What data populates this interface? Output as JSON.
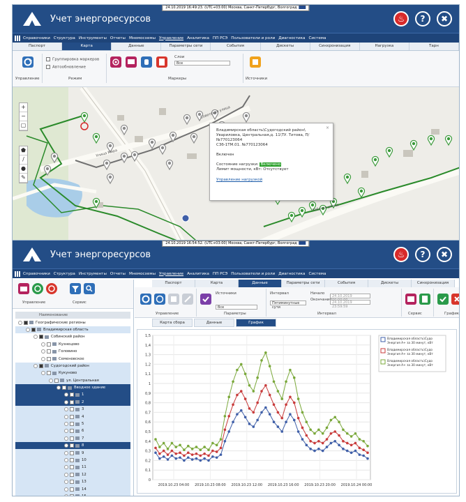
{
  "top_window": {
    "clock": "24.10.2019 16:49:23. (UTC+03:00) Москва, Санкт-Петербург, Волгоград",
    "app_title": "Учет энергоресурсов",
    "menu": [
      "Справочники",
      "Структура",
      "Инструменты",
      "Отчеты",
      "Мнемосхемы",
      "Управление",
      "Аналитика",
      "ПП РСЭ",
      "Пользователи и роли",
      "Диагностика",
      "Система"
    ],
    "active_menu": "Управление",
    "tabs": [
      "Паспорт",
      "Карта",
      "Данные",
      "Параметры сети",
      "События",
      "Дискеты",
      "Синхронизация",
      "Нагрузка",
      "Тарн"
    ],
    "active_tab": "Карта",
    "ribbon": {
      "group_marker_label": "Группировка маркеров",
      "auto_update_label": "Автообновление",
      "mode_label": "Режим",
      "control_label": "Управление",
      "layer_label": "Слои",
      "layer_value": "Все",
      "markers_label": "Маркеры",
      "sources_label": "Источники"
    },
    "popup": {
      "address": "Владимирская область\\Судогодский район\\",
      "street": "Увариловка, Центральная,д. 11\\ТУ. Титова, П/",
      "meter1": "№770123064",
      "meter2": "С3б-1ТМ.01. №770123064",
      "state_line": "Включен",
      "load_state_label": "Состояние нагрузки:",
      "load_state_value": "Включено",
      "power_limit": "Лимит мощности, кВт: Отсутствует",
      "link": "Управление нагрузкой"
    },
    "map_labels": [
      "Улица Мира",
      "Советская улица",
      "Рабочая улица"
    ]
  },
  "bottom_window": {
    "clock": "24.10.2019 16:54:52. (UTC+03:00) Москва, Санкт-Петербург, Волгоград",
    "app_title": "Учет энергоресурсов",
    "menu": [
      "Справочники",
      "Структура",
      "Инструменты",
      "Отчеты",
      "Мнемосхемы",
      "Управление",
      "Аналитика",
      "ПП РСЭ",
      "Пользователи и роли",
      "Диагностика",
      "Система"
    ],
    "active_menu": "Управление",
    "left_ribbon": {
      "control_label": "Управление",
      "service_label": "Сервис"
    },
    "tree_header": "Наименование",
    "tree": [
      {
        "label": "Географические регионы",
        "level": 0,
        "state": "none"
      },
      {
        "label": "Владимирская область",
        "level": 1,
        "state": "sel"
      },
      {
        "label": "Собинский район",
        "level": 2,
        "state": "none"
      },
      {
        "label": "Кузнецово",
        "level": 3,
        "state": "none"
      },
      {
        "label": "Головино",
        "level": 3,
        "state": "none"
      },
      {
        "label": "Семеновское",
        "level": 3,
        "state": "none"
      },
      {
        "label": "Судогодский район",
        "level": 2,
        "state": "sel"
      },
      {
        "label": "Кукуново",
        "level": 3,
        "state": "sel"
      },
      {
        "label": "ул. Центральная",
        "level": 4,
        "state": "sel"
      },
      {
        "label": "Вводное здание",
        "level": 5,
        "state": "hl"
      },
      {
        "label": "1",
        "level": 6,
        "state": "hl"
      },
      {
        "label": "2",
        "level": 6,
        "state": "hl"
      },
      {
        "label": "3",
        "level": 6,
        "state": "sel"
      },
      {
        "label": "4",
        "level": 6,
        "state": "sel"
      },
      {
        "label": "5",
        "level": 6,
        "state": "sel"
      },
      {
        "label": "6",
        "level": 6,
        "state": "sel"
      },
      {
        "label": "7",
        "level": 6,
        "state": "sel"
      },
      {
        "label": "8",
        "level": 6,
        "state": "hl"
      },
      {
        "label": "9",
        "level": 6,
        "state": "sel"
      },
      {
        "label": "10",
        "level": 6,
        "state": "sel"
      },
      {
        "label": "11",
        "level": 6,
        "state": "sel"
      },
      {
        "label": "12",
        "level": 6,
        "state": "sel"
      },
      {
        "label": "13",
        "level": 6,
        "state": "sel"
      },
      {
        "label": "14",
        "level": 6,
        "state": "sel"
      },
      {
        "label": "15",
        "level": 6,
        "state": "sel"
      }
    ],
    "tabs": [
      "Паспорт",
      "Карта",
      "Данные",
      "Параметры сети",
      "События",
      "Дискеты",
      "Синхронизация"
    ],
    "active_tab": "Данные",
    "ribbon": {
      "control_label": "Управление",
      "sources_label": "Источники",
      "sources_value": "Все",
      "params_label": "Параметры",
      "interval_label": "Интервал",
      "interval_value": "Пятиминутные сути",
      "start_label": "Начало",
      "start_value": "24.10.2019 00:00:00",
      "end_label": "Окончание",
      "end_value": "24.10.2019 23:59:59",
      "interval_group_label": "Интервал",
      "service_label": "Сервис",
      "graph_label": "График"
    },
    "subtabs": [
      "Карта сбора",
      "Данные",
      "График"
    ],
    "active_subtab": "График"
  },
  "chart_data": {
    "type": "line",
    "x": [
      "2019.10.23 04:00",
      "2019.10.23 08:00",
      "2019.10.23 12:00",
      "2019.10.23 16:00",
      "2019.10.23 20:00",
      "2019.10.24 00:00"
    ],
    "xticks": [
      "2019.10.23 04:00",
      "2019.10.23 08:00",
      "2019.10.23 12:00",
      "2019.10.23 16:00",
      "2019.10.23 20:00",
      "2019.10.24 00:00"
    ],
    "ylim": [
      0,
      1.5
    ],
    "yticks": [
      "0",
      "0,1",
      "0,2",
      "0,3",
      "0,4",
      "0,5",
      "0,6",
      "0,7",
      "0,8",
      "0,9",
      "1",
      "1,1",
      "1,2",
      "1,3",
      "1,4",
      "1,5"
    ],
    "series": [
      {
        "name": "Владимирская область\\Судо Энергия А+ за 30 минут, кВт",
        "color": "#3f5fa8",
        "values": [
          0.28,
          0.22,
          0.24,
          0.21,
          0.25,
          0.22,
          0.23,
          0.2,
          0.23,
          0.21,
          0.22,
          0.2,
          0.22,
          0.2,
          0.24,
          0.23,
          0.26,
          0.4,
          0.5,
          0.6,
          0.68,
          0.72,
          0.65,
          0.58,
          0.55,
          0.62,
          0.7,
          0.75,
          0.68,
          0.6,
          0.55,
          0.5,
          0.6,
          0.68,
          0.62,
          0.5,
          0.42,
          0.36,
          0.32,
          0.3,
          0.32,
          0.3,
          0.34,
          0.38,
          0.4,
          0.36,
          0.32,
          0.3,
          0.28,
          0.3,
          0.26,
          0.25,
          0.22
        ]
      },
      {
        "name": "Владимирская область\\Судо Энергия А+ за 30 минут, кВт",
        "color": "#c83b3b",
        "values": [
          0.33,
          0.27,
          0.3,
          0.26,
          0.3,
          0.27,
          0.28,
          0.25,
          0.28,
          0.26,
          0.27,
          0.25,
          0.27,
          0.25,
          0.3,
          0.29,
          0.33,
          0.52,
          0.66,
          0.78,
          0.88,
          0.92,
          0.84,
          0.74,
          0.7,
          0.8,
          0.92,
          0.98,
          0.88,
          0.78,
          0.7,
          0.64,
          0.78,
          0.86,
          0.8,
          0.64,
          0.54,
          0.46,
          0.4,
          0.38,
          0.4,
          0.38,
          0.42,
          0.48,
          0.5,
          0.46,
          0.4,
          0.38,
          0.36,
          0.38,
          0.33,
          0.31,
          0.28
        ]
      },
      {
        "name": "Владимирская область\\Судо Энергия А+ за 30 минут, кВт",
        "color": "#7aa83a",
        "values": [
          0.42,
          0.34,
          0.38,
          0.32,
          0.38,
          0.34,
          0.36,
          0.31,
          0.35,
          0.32,
          0.34,
          0.31,
          0.34,
          0.31,
          0.38,
          0.36,
          0.42,
          0.66,
          0.86,
          1.02,
          1.14,
          1.2,
          1.1,
          0.98,
          0.92,
          1.06,
          1.24,
          1.32,
          1.18,
          1.02,
          0.92,
          0.84,
          1.02,
          1.14,
          1.06,
          0.84,
          0.7,
          0.6,
          0.52,
          0.48,
          0.52,
          0.48,
          0.54,
          0.62,
          0.65,
          0.6,
          0.52,
          0.48,
          0.45,
          0.48,
          0.42,
          0.4,
          0.35
        ]
      }
    ]
  }
}
